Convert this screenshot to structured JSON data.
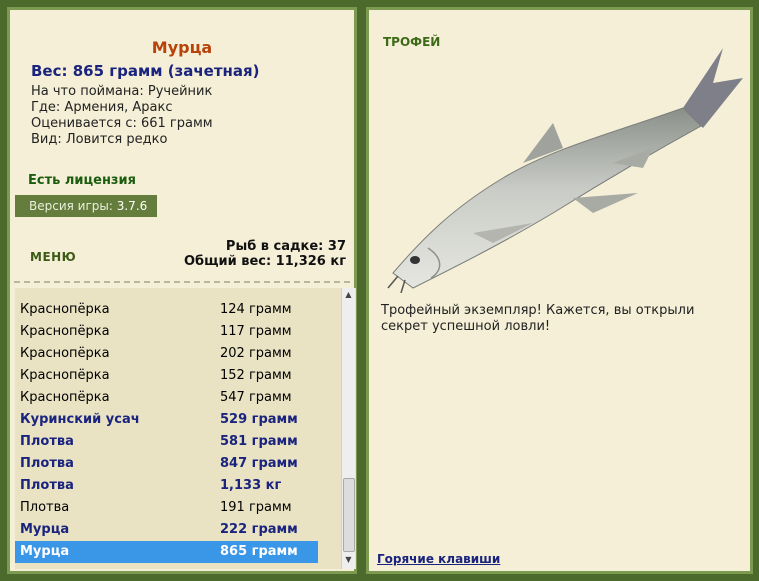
{
  "fish": {
    "name": "Мурца",
    "weight": "Вес: 865 грамм (зачетная)",
    "bait": "На что поймана: Ручейник",
    "location": "Где: Армения, Аракс",
    "value": "Оценивается с: 661 грамм",
    "rarity": "Вид: Ловится редко"
  },
  "license": "Есть лицензия",
  "version": {
    "label": "Версия игры:",
    "value": "3.7.6"
  },
  "menu_label": "МЕНЮ",
  "stats": {
    "fish_count": "Рыб в садке: 37",
    "total_weight": "Общий вес: 11,326 кг"
  },
  "catch_list": [
    {
      "name": "Краснопёрка",
      "weight": "124 грамм",
      "bold": false
    },
    {
      "name": "Краснопёрка",
      "weight": "117 грамм",
      "bold": false
    },
    {
      "name": "Краснопёрка",
      "weight": "202 грамм",
      "bold": false
    },
    {
      "name": "Краснопёрка",
      "weight": "152 грамм",
      "bold": false
    },
    {
      "name": "Краснопёрка",
      "weight": "547 грамм",
      "bold": false
    },
    {
      "name": "Куринский усач",
      "weight": "529 грамм",
      "bold": true
    },
    {
      "name": "Плотва",
      "weight": "581 грамм",
      "bold": true
    },
    {
      "name": "Плотва",
      "weight": "847 грамм",
      "bold": true
    },
    {
      "name": "Плотва",
      "weight": "1,133 кг",
      "bold": true
    },
    {
      "name": "Плотва",
      "weight": "191 грамм",
      "bold": false
    },
    {
      "name": "Мурца",
      "weight": "222 грамм",
      "bold": true
    },
    {
      "name": "Мурца",
      "weight": "865 грамм",
      "bold": true,
      "selected": true
    }
  ],
  "trophy_label": "ТРОФЕЙ",
  "trophy_text": "Трофейный экземпляр! Кажется, вы открыли секрет успешной ловли!",
  "hotkeys_label": "Горячие клавиши",
  "colors": {
    "selection": "#3a96e6",
    "frame": "#7c9a50",
    "background": "#4b6a2c"
  }
}
